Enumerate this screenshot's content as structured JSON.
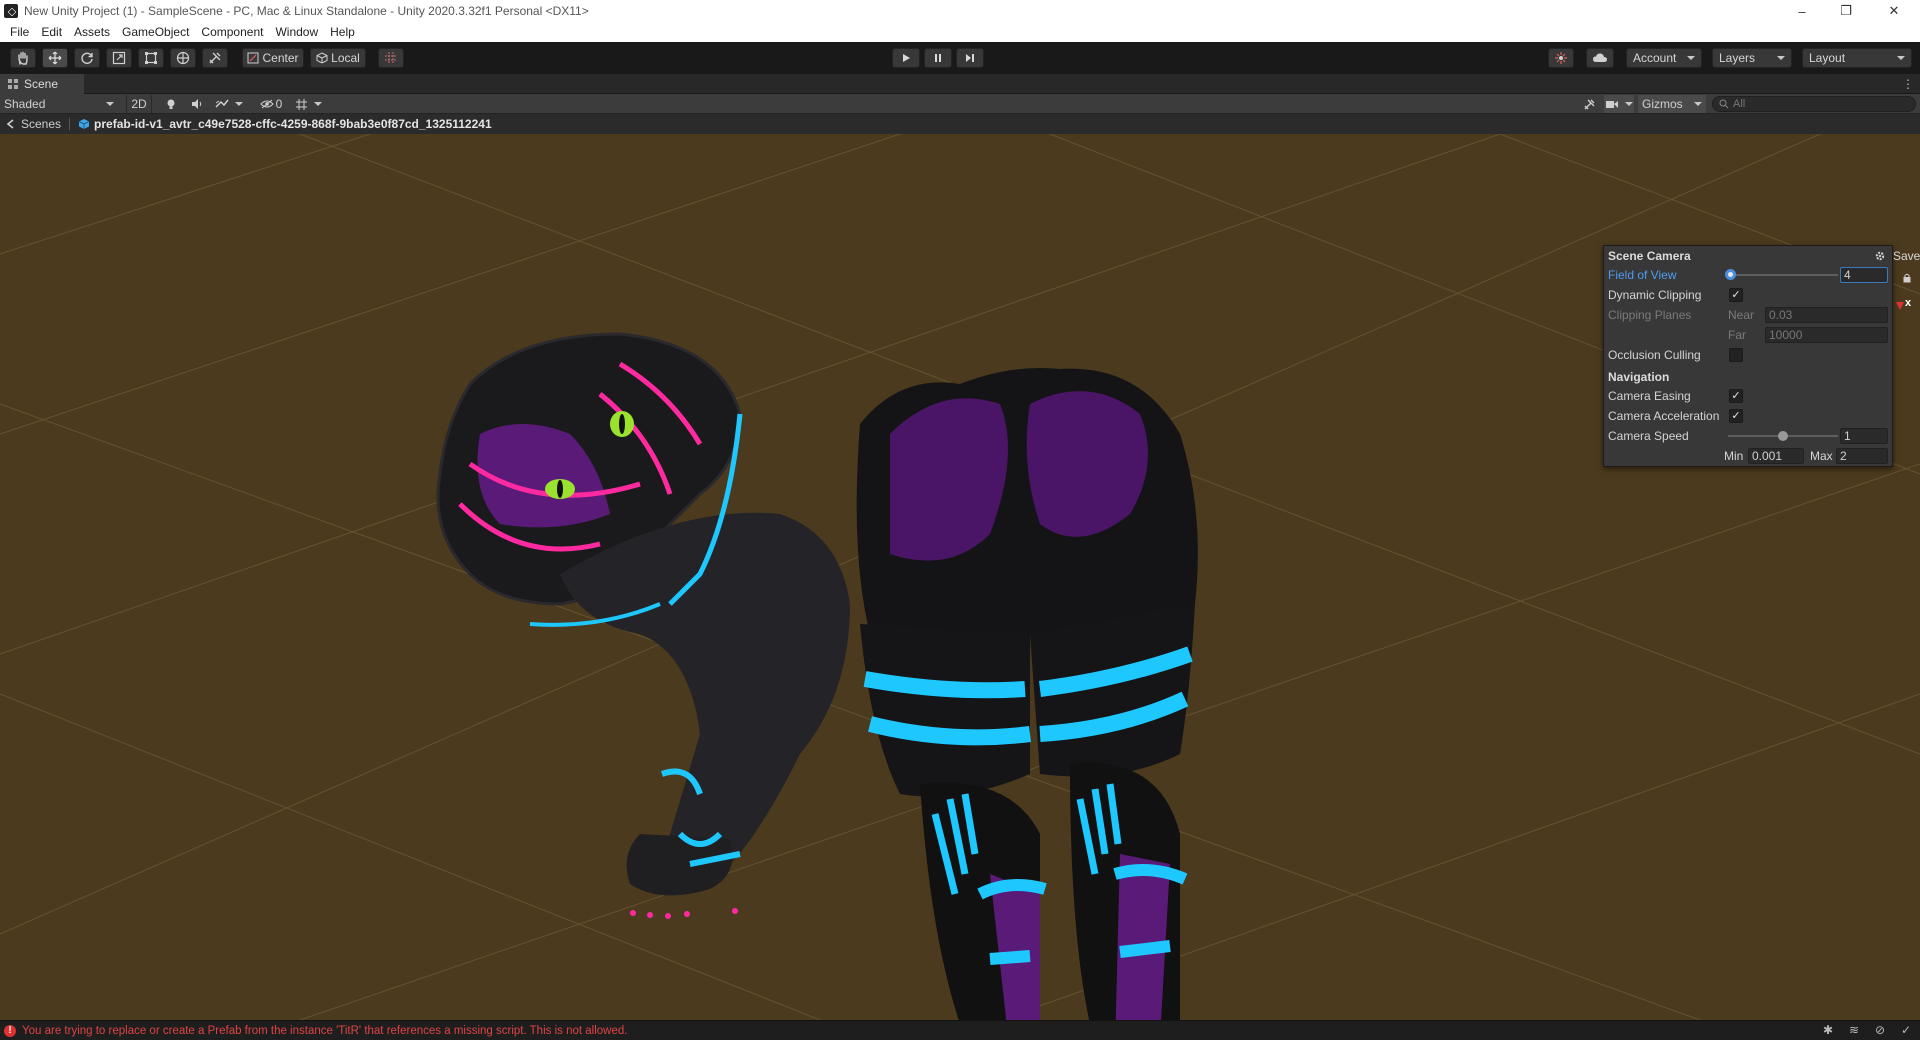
{
  "window": {
    "title": "New Unity Project (1) - SampleScene - PC, Mac & Linux Standalone - Unity 2020.3.32f1 Personal <DX11>",
    "controls": [
      "–",
      "❐",
      "✕"
    ]
  },
  "menu": [
    "File",
    "Edit",
    "Assets",
    "GameObject",
    "Component",
    "Window",
    "Help"
  ],
  "toolbar": {
    "pivot_label": "Center",
    "space_label": "Local",
    "account_label": "Account",
    "layers_label": "Layers",
    "layout_label": "Layout"
  },
  "scene_tab": {
    "label": "Scene"
  },
  "scene_toolbar": {
    "shading_mode": "Shaded",
    "mode_2d": "2D",
    "hidden_count": "0",
    "gizmos_label": "Gizmos",
    "search_placeholder": "All"
  },
  "breadcrumb": {
    "scenes_label": "Scenes",
    "prefab_name": "prefab-id-v1_avtr_c49e7528-cffc-4259-868f-9bab3e0f87cd_1325112241",
    "save_label": "Save"
  },
  "scene_camera": {
    "title": "Scene Camera",
    "field_of_view_label": "Field of View",
    "field_of_view_value": "4",
    "field_of_view_fraction": 0.02,
    "dynamic_clipping_label": "Dynamic Clipping",
    "dynamic_clipping": true,
    "clipping_planes_label": "Clipping Planes",
    "near_label": "Near",
    "near_value": "0.03",
    "far_label": "Far",
    "far_value": "10000",
    "occlusion_culling_label": "Occlusion Culling",
    "occlusion_culling": false,
    "navigation_title": "Navigation",
    "camera_easing_label": "Camera Easing",
    "camera_easing": true,
    "camera_acceleration_label": "Camera Acceleration",
    "camera_acceleration": true,
    "camera_speed_label": "Camera Speed",
    "camera_speed_value": "1",
    "camera_speed_fraction": 0.5,
    "min_label": "Min",
    "min_value": "0.001",
    "max_label": "Max",
    "max_value": "2"
  },
  "status": {
    "error_message": "You are trying to replace or create a Prefab from the instance 'TitR' that references a missing script. This is not allowed."
  },
  "colors": {
    "viewport_bg": "#4b3a1d",
    "accent_blue": "#4e9df0",
    "error_red": "#e03131",
    "avatar_cyan": "#1ec8ff",
    "avatar_magenta": "#ff2aa0",
    "avatar_purple": "#5a1a78"
  }
}
